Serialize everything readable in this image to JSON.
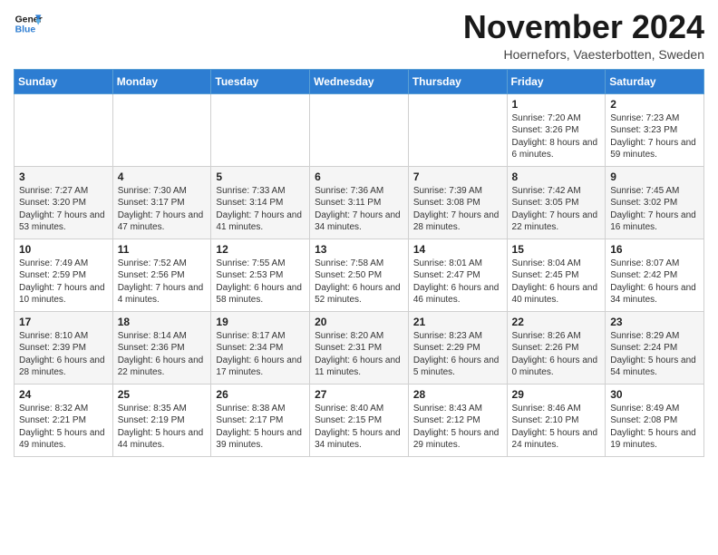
{
  "header": {
    "logo_line1": "General",
    "logo_line2": "Blue",
    "month_title": "November 2024",
    "subtitle": "Hoernefors, Vaesterbotten, Sweden"
  },
  "weekdays": [
    "Sunday",
    "Monday",
    "Tuesday",
    "Wednesday",
    "Thursday",
    "Friday",
    "Saturday"
  ],
  "weeks": [
    [
      {
        "day": "",
        "info": ""
      },
      {
        "day": "",
        "info": ""
      },
      {
        "day": "",
        "info": ""
      },
      {
        "day": "",
        "info": ""
      },
      {
        "day": "",
        "info": ""
      },
      {
        "day": "1",
        "info": "Sunrise: 7:20 AM\nSunset: 3:26 PM\nDaylight: 8 hours and 6 minutes."
      },
      {
        "day": "2",
        "info": "Sunrise: 7:23 AM\nSunset: 3:23 PM\nDaylight: 7 hours and 59 minutes."
      }
    ],
    [
      {
        "day": "3",
        "info": "Sunrise: 7:27 AM\nSunset: 3:20 PM\nDaylight: 7 hours and 53 minutes."
      },
      {
        "day": "4",
        "info": "Sunrise: 7:30 AM\nSunset: 3:17 PM\nDaylight: 7 hours and 47 minutes."
      },
      {
        "day": "5",
        "info": "Sunrise: 7:33 AM\nSunset: 3:14 PM\nDaylight: 7 hours and 41 minutes."
      },
      {
        "day": "6",
        "info": "Sunrise: 7:36 AM\nSunset: 3:11 PM\nDaylight: 7 hours and 34 minutes."
      },
      {
        "day": "7",
        "info": "Sunrise: 7:39 AM\nSunset: 3:08 PM\nDaylight: 7 hours and 28 minutes."
      },
      {
        "day": "8",
        "info": "Sunrise: 7:42 AM\nSunset: 3:05 PM\nDaylight: 7 hours and 22 minutes."
      },
      {
        "day": "9",
        "info": "Sunrise: 7:45 AM\nSunset: 3:02 PM\nDaylight: 7 hours and 16 minutes."
      }
    ],
    [
      {
        "day": "10",
        "info": "Sunrise: 7:49 AM\nSunset: 2:59 PM\nDaylight: 7 hours and 10 minutes."
      },
      {
        "day": "11",
        "info": "Sunrise: 7:52 AM\nSunset: 2:56 PM\nDaylight: 7 hours and 4 minutes."
      },
      {
        "day": "12",
        "info": "Sunrise: 7:55 AM\nSunset: 2:53 PM\nDaylight: 6 hours and 58 minutes."
      },
      {
        "day": "13",
        "info": "Sunrise: 7:58 AM\nSunset: 2:50 PM\nDaylight: 6 hours and 52 minutes."
      },
      {
        "day": "14",
        "info": "Sunrise: 8:01 AM\nSunset: 2:47 PM\nDaylight: 6 hours and 46 minutes."
      },
      {
        "day": "15",
        "info": "Sunrise: 8:04 AM\nSunset: 2:45 PM\nDaylight: 6 hours and 40 minutes."
      },
      {
        "day": "16",
        "info": "Sunrise: 8:07 AM\nSunset: 2:42 PM\nDaylight: 6 hours and 34 minutes."
      }
    ],
    [
      {
        "day": "17",
        "info": "Sunrise: 8:10 AM\nSunset: 2:39 PM\nDaylight: 6 hours and 28 minutes."
      },
      {
        "day": "18",
        "info": "Sunrise: 8:14 AM\nSunset: 2:36 PM\nDaylight: 6 hours and 22 minutes."
      },
      {
        "day": "19",
        "info": "Sunrise: 8:17 AM\nSunset: 2:34 PM\nDaylight: 6 hours and 17 minutes."
      },
      {
        "day": "20",
        "info": "Sunrise: 8:20 AM\nSunset: 2:31 PM\nDaylight: 6 hours and 11 minutes."
      },
      {
        "day": "21",
        "info": "Sunrise: 8:23 AM\nSunset: 2:29 PM\nDaylight: 6 hours and 5 minutes."
      },
      {
        "day": "22",
        "info": "Sunrise: 8:26 AM\nSunset: 2:26 PM\nDaylight: 6 hours and 0 minutes."
      },
      {
        "day": "23",
        "info": "Sunrise: 8:29 AM\nSunset: 2:24 PM\nDaylight: 5 hours and 54 minutes."
      }
    ],
    [
      {
        "day": "24",
        "info": "Sunrise: 8:32 AM\nSunset: 2:21 PM\nDaylight: 5 hours and 49 minutes."
      },
      {
        "day": "25",
        "info": "Sunrise: 8:35 AM\nSunset: 2:19 PM\nDaylight: 5 hours and 44 minutes."
      },
      {
        "day": "26",
        "info": "Sunrise: 8:38 AM\nSunset: 2:17 PM\nDaylight: 5 hours and 39 minutes."
      },
      {
        "day": "27",
        "info": "Sunrise: 8:40 AM\nSunset: 2:15 PM\nDaylight: 5 hours and 34 minutes."
      },
      {
        "day": "28",
        "info": "Sunrise: 8:43 AM\nSunset: 2:12 PM\nDaylight: 5 hours and 29 minutes."
      },
      {
        "day": "29",
        "info": "Sunrise: 8:46 AM\nSunset: 2:10 PM\nDaylight: 5 hours and 24 minutes."
      },
      {
        "day": "30",
        "info": "Sunrise: 8:49 AM\nSunset: 2:08 PM\nDaylight: 5 hours and 19 minutes."
      }
    ]
  ]
}
